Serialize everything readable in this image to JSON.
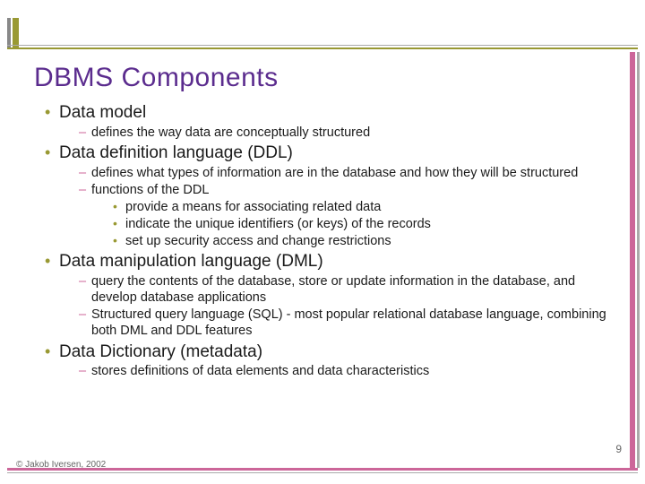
{
  "title": "DBMS Components",
  "b1": {
    "t": "Data model",
    "s1": "defines the way data are conceptually structured"
  },
  "b2": {
    "t": "Data definition language (DDL)",
    "s1": "defines what types of information are in the database and how they will be structured",
    "s2": "functions of the DDL",
    "s2a": "provide a means for associating related data",
    "s2b": "indicate the unique identifiers (or keys) of the records",
    "s2c": "set up security access and change restrictions"
  },
  "b3": {
    "t": "Data manipulation language (DML)",
    "s1": "query the contents of the database, store or update information in the database, and develop database applications",
    "s2": "Structured query language (SQL) - most popular relational database language, combining both DML and DDL features"
  },
  "b4": {
    "t": "Data Dictionary (metadata)",
    "s1": "stores definitions of data elements and data characteristics"
  },
  "copyright": "© Jakob Iversen, 2002",
  "pagenum": "9"
}
